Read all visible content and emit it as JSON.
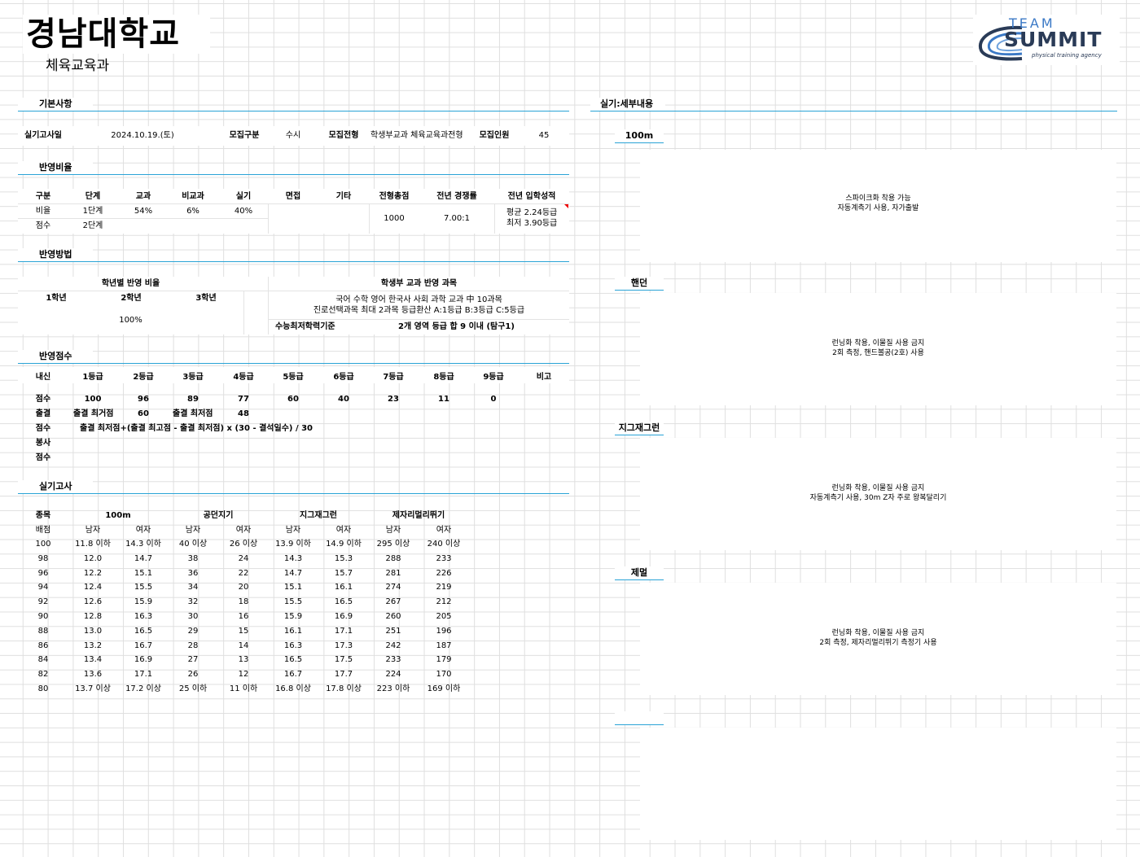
{
  "header": {
    "school": "경남대학교",
    "dept": "체육교육과"
  },
  "logo": {
    "line1": "TEAM",
    "line2": "SUMMIT",
    "line3": "physical training agency"
  },
  "basic": {
    "section": "기본사항",
    "exam_date_label": "실기고사일",
    "exam_date": "2024.10.19.(토)",
    "category_label": "모집구분",
    "category": "수시",
    "type_label": "모집전형",
    "type": "학생부교과 체육교육과전형",
    "quota_label": "모집인원",
    "quota": "45"
  },
  "ratio": {
    "section": "반영비율",
    "headers": [
      "구분",
      "단계",
      "교과",
      "비교과",
      "실기",
      "면접",
      "기타",
      "전형총점",
      "전년 경쟁률",
      "전년 입학성적"
    ],
    "row1": [
      "비율",
      "1단계",
      "54%",
      "6%",
      "40%"
    ],
    "row2": [
      "점수",
      "2단계"
    ],
    "total": "1000",
    "competition": "7.00:1",
    "grade_avg": "평균 2.24등급",
    "grade_min": "최저 3.90등급"
  },
  "method": {
    "section": "반영방법",
    "grade_ratio_title": "학년별 반영 비율",
    "grades": [
      "1학년",
      "2학년",
      "3학년"
    ],
    "grade_value": "100%",
    "subject_title": "학생부 교과 반영 과목",
    "subject_line1": "국어 수학 영어 한국사 사회 과학 교과 中 10과목",
    "subject_line2": "진로선택과목 최대 2과목 등급환산 A:1등급 B:3등급 C:5등급",
    "csat_label": "수능최저학력기준",
    "csat_value": "2개 영역 등급 합 9 이내 (탐구1)"
  },
  "score": {
    "section": "반영점수",
    "header": [
      "내신",
      "1등급",
      "2등급",
      "3등급",
      "4등급",
      "5등급",
      "6등급",
      "7등급",
      "8등급",
      "9등급",
      "비고"
    ],
    "points": [
      "점수",
      "100",
      "96",
      "89",
      "77",
      "60",
      "40",
      "23",
      "11",
      "0"
    ],
    "attend_label": "출결",
    "attend_max_label": "출결 최거점",
    "attend_max": "60",
    "attend_min_label": "출결 최저점",
    "attend_min": "48",
    "score_label": "점수",
    "formula": "출결 최저점+(출결 최고점 - 출결 최저점) x (30 - 결석일수) / 30",
    "service_label": "봉사",
    "service_score_label": "점수"
  },
  "practical": {
    "section": "실기고사",
    "events": [
      "100m",
      "공던지기",
      "지그재그런",
      "제자리멀리뛰기"
    ],
    "item_label": "종목",
    "points_label": "배점",
    "male": "남자",
    "female": "여자",
    "rows": [
      [
        "100",
        "11.8 이하",
        "14.3 이하",
        "40 이상",
        "26 이상",
        "13.9 이하",
        "14.9 이하",
        "295 이상",
        "240 이상"
      ],
      [
        "98",
        "12.0",
        "14.7",
        "38",
        "24",
        "14.3",
        "15.3",
        "288",
        "233"
      ],
      [
        "96",
        "12.2",
        "15.1",
        "36",
        "22",
        "14.7",
        "15.7",
        "281",
        "226"
      ],
      [
        "94",
        "12.4",
        "15.5",
        "34",
        "20",
        "15.1",
        "16.1",
        "274",
        "219"
      ],
      [
        "92",
        "12.6",
        "15.9",
        "32",
        "18",
        "15.5",
        "16.5",
        "267",
        "212"
      ],
      [
        "90",
        "12.8",
        "16.3",
        "30",
        "16",
        "15.9",
        "16.9",
        "260",
        "205"
      ],
      [
        "88",
        "13.0",
        "16.5",
        "29",
        "15",
        "16.1",
        "17.1",
        "251",
        "196"
      ],
      [
        "86",
        "13.2",
        "16.7",
        "28",
        "14",
        "16.3",
        "17.3",
        "242",
        "187"
      ],
      [
        "84",
        "13.4",
        "16.9",
        "27",
        "13",
        "16.5",
        "17.5",
        "233",
        "179"
      ],
      [
        "82",
        "13.6",
        "17.1",
        "26",
        "12",
        "16.7",
        "17.7",
        "224",
        "170"
      ],
      [
        "80",
        "13.7 이상",
        "17.2 이상",
        "25 이하",
        "11 이하",
        "16.8 이상",
        "17.8 이상",
        "223 이하",
        "169 이하"
      ]
    ]
  },
  "detail": {
    "section": "실기:세부내용",
    "items": [
      {
        "title": "100m",
        "line1": "스파이크화 착용 가능",
        "line2": "자동계측기 사용, 자가출발"
      },
      {
        "title": "핸던",
        "line1": "런닝화 착용, 이물질 사용 금지",
        "line2": "2회 측정, 핸드볼공(2호) 사용"
      },
      {
        "title": "지그재그런",
        "line1": "런닝화 착용, 이물질 사용 금지",
        "line2": "자동계측기 사용, 30m Z자 주로 왕복달리기"
      },
      {
        "title": "제멀",
        "line1": "런닝화 착용, 이물질 사용 금지",
        "line2": "2회 측정, 제자리멀리뛰기 측정기 사용"
      }
    ]
  }
}
